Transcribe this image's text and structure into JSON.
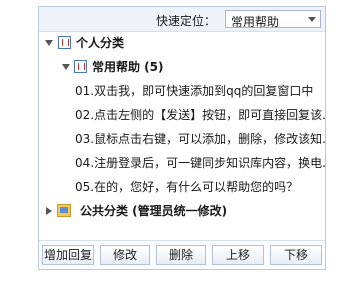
{
  "quick_locate": {
    "label": "快速定位：",
    "selected": "常用帮助"
  },
  "tree": {
    "personal": {
      "label": "个人分类",
      "children": {
        "common_help": {
          "label": "常用帮助 (5)",
          "items": [
            "01.双击我，即可快速添加到qq的回复窗口中",
            "02.点击左侧的【发送】按钮，即可直接回复该...",
            "03.鼠标点击右键，可以添加，删除，修改该知...",
            "04.注册登录后，可一键同步知识库内容，换电...",
            "05.在的，您好，有什么可以帮助您的吗？"
          ]
        }
      }
    },
    "public": {
      "label": "公共分类 (管理员统一修改)"
    }
  },
  "buttons": {
    "add_reply": "增加回复",
    "edit": "修改",
    "delete": "删除",
    "move_up": "上移",
    "move_down": "下移"
  }
}
